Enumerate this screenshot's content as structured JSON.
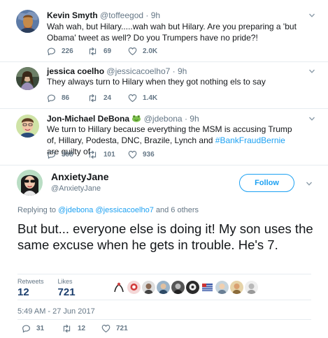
{
  "replies": [
    {
      "name": "Kevin Smyth",
      "handle": "@toffeegod · 9h",
      "text": "Wah wah, but Hilary.....wah wah but Hilary. Are you preparing a 'but Obama' tweet as well? Do you Trumpers have no pride?!",
      "reply_count": "226",
      "retweet_count": "69",
      "like_count": "2.0K"
    },
    {
      "name": "jessica coelho",
      "handle": "@jessicacoelho7 · 9h",
      "text": "They always turn to Hilary when they got nothing els to say",
      "reply_count": "86",
      "retweet_count": "24",
      "like_count": "1.4K"
    },
    {
      "name": "Jon-Michael DeBona",
      "handle": "@jdebona · 9h",
      "text_before": "We turn to Hillary because everything the MSM is accusing Trump of, Hillary, Podesta, DNC, Brazile, Lynch and ",
      "hashtag": "#BankFraudBernie",
      "text_after": " are guilty of",
      "reply_count": "308",
      "retweet_count": "101",
      "like_count": "936"
    }
  ],
  "main": {
    "name": "AnxietyJane",
    "handle": "@AnxietyJane",
    "follow_label": "Follow",
    "replying_prefix": "Replying to ",
    "replying_user1": "@jdebona",
    "replying_user2": "@jessicacoelho7",
    "replying_suffix": " and 6 others",
    "text": "But but... everyone else is doing it! My son uses the same excuse when he gets in trouble. He's 7.",
    "retweets_label": "Retweets",
    "retweets_value": "12",
    "likes_label": "Likes",
    "likes_value": "721",
    "timestamp": "5:49 AM - 27 Jun 2017",
    "reply_count": "31",
    "retweet_count": "12",
    "like_count": "721"
  },
  "colors": {
    "link": "#1da1f2",
    "secondary": "#657786",
    "stat_value": "#1c3f6e"
  },
  "icons": [
    "reply-icon",
    "retweet-icon",
    "heart-icon",
    "chevron-down-icon",
    "frog-emoji-icon"
  ]
}
